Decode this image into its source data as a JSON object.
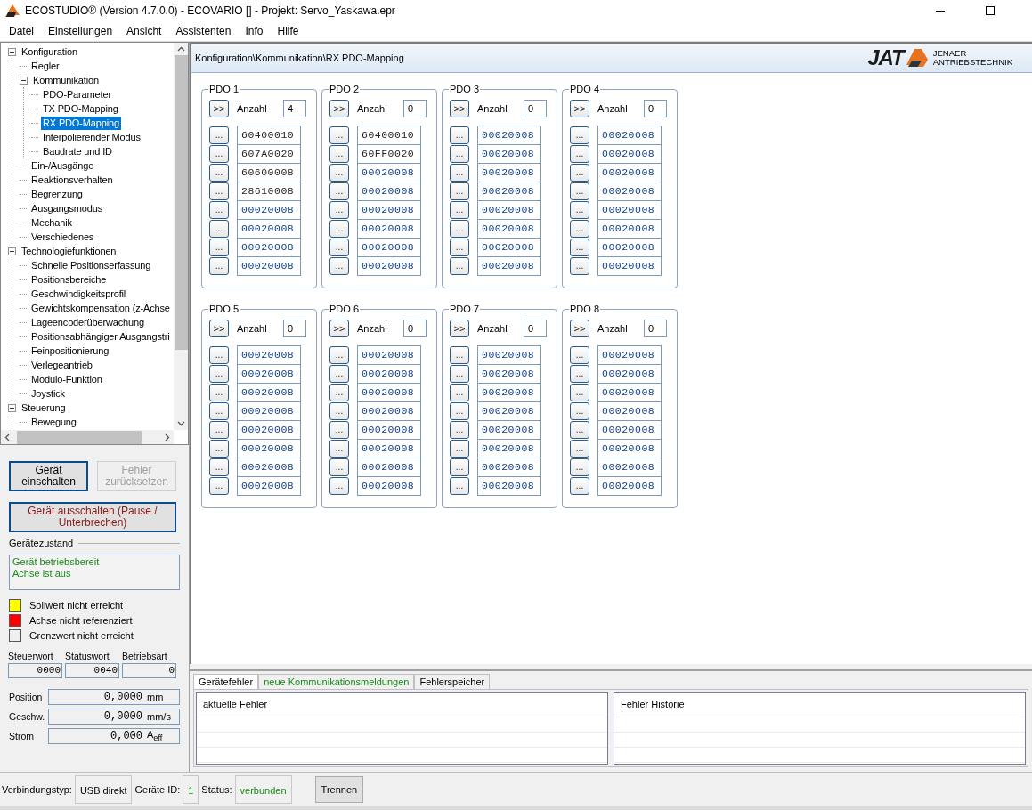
{
  "window": {
    "title": "ECOSTUDIO® (Version 4.7.0.0) - ECOVARIO [] - Projekt: Servo_Yaskawa.epr"
  },
  "menu": [
    "Datei",
    "Einstellungen",
    "Ansicht",
    "Assistenten",
    "Info",
    "Hilfe"
  ],
  "tree": [
    {
      "label": "Konfiguration",
      "expanded": true,
      "selected": false,
      "children": [
        {
          "label": "Regler",
          "selected": false
        },
        {
          "label": "Kommunikation",
          "expanded": true,
          "selected": false,
          "children": [
            {
              "label": "PDO-Parameter",
              "selected": false
            },
            {
              "label": "TX PDO-Mapping",
              "selected": false
            },
            {
              "label": "RX PDO-Mapping",
              "selected": true
            },
            {
              "label": "Interpolierender Modus",
              "selected": false
            },
            {
              "label": "Baudrate und ID",
              "selected": false
            }
          ]
        },
        {
          "label": "Ein-/Ausgänge",
          "selected": false
        },
        {
          "label": "Reaktionsverhalten",
          "selected": false
        },
        {
          "label": "Begrenzung",
          "selected": false
        },
        {
          "label": "Ausgangsmodus",
          "selected": false
        },
        {
          "label": "Mechanik",
          "selected": false
        },
        {
          "label": "Verschiedenes",
          "selected": false
        }
      ]
    },
    {
      "label": "Technologiefunktionen",
      "expanded": true,
      "selected": false,
      "children": [
        {
          "label": "Schnelle Positionserfassung",
          "selected": false
        },
        {
          "label": "Positionsbereiche",
          "selected": false
        },
        {
          "label": "Geschwindigkeitsprofil",
          "selected": false
        },
        {
          "label": "Gewichtskompensation (z-Achse",
          "selected": false
        },
        {
          "label": "Lageencoderüberwachung",
          "selected": false
        },
        {
          "label": "Positionsabhängiger Ausgangstri",
          "selected": false
        },
        {
          "label": "Feinpositionierung",
          "selected": false
        },
        {
          "label": "Verlegeantrieb",
          "selected": false
        },
        {
          "label": "Modulo-Funktion",
          "selected": false
        },
        {
          "label": "Joystick",
          "selected": false
        }
      ]
    },
    {
      "label": "Steuerung",
      "expanded": true,
      "selected": false,
      "children": [
        {
          "label": "Bewegung",
          "selected": false
        }
      ]
    }
  ],
  "control_buttons": [
    {
      "label": "Gerät einschalten",
      "kind": "normal",
      "disabled": false
    },
    {
      "label": "Fehler zurücksetzen",
      "kind": "normal",
      "disabled": true
    },
    {
      "label": "Gerät ausschalten (Pause / Unterbrechen)",
      "kind": "stop",
      "disabled": false
    }
  ],
  "device_state": {
    "title": "Gerätezustand",
    "lines": [
      "Gerät betriebsbereit",
      "Achse ist aus"
    ]
  },
  "indicators": [
    {
      "label": "Sollwert nicht erreicht",
      "color": "#ffff00"
    },
    {
      "label": "Achse nicht referenziert",
      "color": "#ff0000"
    },
    {
      "label": "Grenzwert nicht erreicht",
      "color": "#f0f0f0"
    }
  ],
  "words": [
    {
      "label": "Steuerwort",
      "value": "0000"
    },
    {
      "label": "Statuswort",
      "value": "0040"
    },
    {
      "label": "Betriebsart",
      "value": "0"
    }
  ],
  "readouts": [
    {
      "label": "Position",
      "value": "0,0000",
      "unit": "mm"
    },
    {
      "label": "Geschw.",
      "value": "0,0000",
      "unit": "mm/s"
    },
    {
      "label": "Strom",
      "value": "0,000",
      "unit": "A$_{eff}$"
    }
  ],
  "breadcrumb": "Konfiguration\\Kommunikation\\RX PDO-Mapping",
  "logo": {
    "mark": "JAT",
    "line1": "JENAER",
    "line2": "ANTRIEBSTECHNIK"
  },
  "pdo_groups": [
    {
      "title": "PDO 1",
      "arrow": ">>",
      "count_label": "Anzahl",
      "count": "4",
      "entries": [
        {
          "value": "60400010",
          "mapped": true
        },
        {
          "value": "607A0020",
          "mapped": true
        },
        {
          "value": "60600008",
          "mapped": true
        },
        {
          "value": "28610008",
          "mapped": true
        },
        {
          "value": "00020008",
          "mapped": false
        },
        {
          "value": "00020008",
          "mapped": false
        },
        {
          "value": "00020008",
          "mapped": false
        },
        {
          "value": "00020008",
          "mapped": false
        }
      ]
    },
    {
      "title": "PDO 2",
      "arrow": ">>",
      "count_label": "Anzahl",
      "count": "0",
      "entries": [
        {
          "value": "60400010",
          "mapped": true
        },
        {
          "value": "60FF0020",
          "mapped": true
        },
        {
          "value": "00020008",
          "mapped": false
        },
        {
          "value": "00020008",
          "mapped": false
        },
        {
          "value": "00020008",
          "mapped": false
        },
        {
          "value": "00020008",
          "mapped": false
        },
        {
          "value": "00020008",
          "mapped": false
        },
        {
          "value": "00020008",
          "mapped": false
        }
      ]
    },
    {
      "title": "PDO 3",
      "arrow": ">>",
      "count_label": "Anzahl",
      "count": "0",
      "entries": [
        {
          "value": "00020008",
          "mapped": false
        },
        {
          "value": "00020008",
          "mapped": false
        },
        {
          "value": "00020008",
          "mapped": false
        },
        {
          "value": "00020008",
          "mapped": false
        },
        {
          "value": "00020008",
          "mapped": false
        },
        {
          "value": "00020008",
          "mapped": false
        },
        {
          "value": "00020008",
          "mapped": false
        },
        {
          "value": "00020008",
          "mapped": false
        }
      ]
    },
    {
      "title": "PDO 4",
      "arrow": ">>",
      "count_label": "Anzahl",
      "count": "0",
      "entries": [
        {
          "value": "00020008",
          "mapped": false
        },
        {
          "value": "00020008",
          "mapped": false
        },
        {
          "value": "00020008",
          "mapped": false
        },
        {
          "value": "00020008",
          "mapped": false
        },
        {
          "value": "00020008",
          "mapped": false
        },
        {
          "value": "00020008",
          "mapped": false
        },
        {
          "value": "00020008",
          "mapped": false
        },
        {
          "value": "00020008",
          "mapped": false
        }
      ]
    },
    {
      "title": "PDO 5",
      "arrow": ">>",
      "count_label": "Anzahl",
      "count": "0",
      "entries": [
        {
          "value": "00020008",
          "mapped": false
        },
        {
          "value": "00020008",
          "mapped": false
        },
        {
          "value": "00020008",
          "mapped": false
        },
        {
          "value": "00020008",
          "mapped": false
        },
        {
          "value": "00020008",
          "mapped": false
        },
        {
          "value": "00020008",
          "mapped": false
        },
        {
          "value": "00020008",
          "mapped": false
        },
        {
          "value": "00020008",
          "mapped": false
        }
      ]
    },
    {
      "title": "PDO 6",
      "arrow": ">>",
      "count_label": "Anzahl",
      "count": "0",
      "entries": [
        {
          "value": "00020008",
          "mapped": false
        },
        {
          "value": "00020008",
          "mapped": false
        },
        {
          "value": "00020008",
          "mapped": false
        },
        {
          "value": "00020008",
          "mapped": false
        },
        {
          "value": "00020008",
          "mapped": false
        },
        {
          "value": "00020008",
          "mapped": false
        },
        {
          "value": "00020008",
          "mapped": false
        },
        {
          "value": "00020008",
          "mapped": false
        }
      ]
    },
    {
      "title": "PDO 7",
      "arrow": ">>",
      "count_label": "Anzahl",
      "count": "0",
      "entries": [
        {
          "value": "00020008",
          "mapped": false
        },
        {
          "value": "00020008",
          "mapped": false
        },
        {
          "value": "00020008",
          "mapped": false
        },
        {
          "value": "00020008",
          "mapped": false
        },
        {
          "value": "00020008",
          "mapped": false
        },
        {
          "value": "00020008",
          "mapped": false
        },
        {
          "value": "00020008",
          "mapped": false
        },
        {
          "value": "00020008",
          "mapped": false
        }
      ]
    },
    {
      "title": "PDO 8",
      "arrow": ">>",
      "count_label": "Anzahl",
      "count": "0",
      "entries": [
        {
          "value": "00020008",
          "mapped": false
        },
        {
          "value": "00020008",
          "mapped": false
        },
        {
          "value": "00020008",
          "mapped": false
        },
        {
          "value": "00020008",
          "mapped": false
        },
        {
          "value": "00020008",
          "mapped": false
        },
        {
          "value": "00020008",
          "mapped": false
        },
        {
          "value": "00020008",
          "mapped": false
        },
        {
          "value": "00020008",
          "mapped": false
        }
      ]
    }
  ],
  "entry_button": "...",
  "error_tabs": [
    {
      "label": "Gerätefehler",
      "selected": true,
      "alert": false
    },
    {
      "label": "neue Kommunikationsmeldungen",
      "selected": false,
      "alert": true
    },
    {
      "label": "Fehlerspeicher",
      "selected": false,
      "alert": false
    }
  ],
  "error_lists": [
    {
      "header": "aktuelle Fehler"
    },
    {
      "header": "Fehler Historie"
    }
  ],
  "status_bar": {
    "connection_label": "Verbindungstyp:",
    "connection": "USB direkt",
    "id_label": "Geräte ID:",
    "id": "1",
    "status_label": "Status:",
    "status": "verbunden",
    "disconnect": "Trennen"
  }
}
